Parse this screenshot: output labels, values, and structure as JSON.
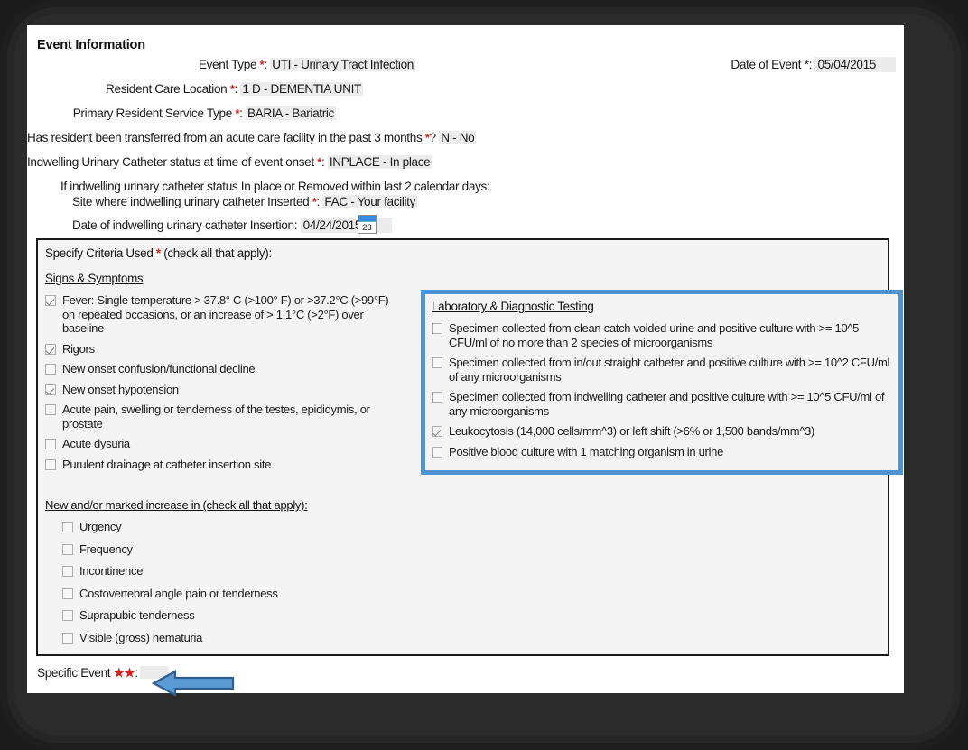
{
  "section": {
    "title": "Event Information"
  },
  "fields": [
    {
      "label": "Event Type",
      "required": true,
      "sep": ":",
      "value": "UTI - Urinary Tract Infection"
    },
    {
      "label": "Resident Care Location",
      "required": true,
      "sep": ":",
      "value": "1 D - DEMENTIA UNIT"
    },
    {
      "label": "Primary Resident Service Type",
      "required": true,
      "sep": ":",
      "value": "BARIA - Bariatric"
    },
    {
      "label": "Has resident been transferred from an acute care facility in the past 3 months",
      "required": true,
      "sep": "?",
      "value": "N - No"
    },
    {
      "label": "Indwelling Urinary Catheter status at time of event onset",
      "required": true,
      "sep": ":",
      "value": "INPLACE - In place"
    }
  ],
  "date_of_event": {
    "label": "Date of Event",
    "sep": ":",
    "value": "05/04/2015"
  },
  "conditional": {
    "note": "If indwelling urinary catheter status In place or Removed within last 2 calendar days:",
    "site_label": "Site where indwelling urinary catheter Inserted",
    "site_sep": ":",
    "site_value": "FAC - Your facility",
    "insertion_label": "Date of indwelling urinary catheter Insertion:",
    "insertion_value": "04/24/2015",
    "calendar_icon_day": "23"
  },
  "criteria": {
    "heading_pre": "Specify Criteria Used",
    "heading_post": "(check all that apply):",
    "signs_heading": "Signs & Symptoms",
    "signs": [
      {
        "label": "Fever: Single temperature > 37.8° C (>100° F) or >37.2°C (>99°F) on repeated occasions, or an increase of > 1.1°C (>2°F) over baseline",
        "checked": true
      },
      {
        "label": "Rigors",
        "checked": true
      },
      {
        "label": "New onset confusion/functional decline",
        "checked": false
      },
      {
        "label": "New onset hypotension",
        "checked": true
      },
      {
        "label": "Acute pain, swelling or tenderness of the testes, epididymis, or prostate",
        "checked": false
      },
      {
        "label": "Acute dysuria",
        "checked": false
      },
      {
        "label": "Purulent drainage at catheter insertion site",
        "checked": false
      }
    ],
    "increase_heading": "New and/or marked increase in (check all that apply):",
    "increase": [
      {
        "label": "Urgency",
        "checked": false
      },
      {
        "label": "Frequency",
        "checked": false
      },
      {
        "label": "Incontinence",
        "checked": false
      },
      {
        "label": "Costovertebral angle pain or tenderness",
        "checked": false
      },
      {
        "label": "Suprapubic tenderness",
        "checked": false
      },
      {
        "label": "Visible (gross) hematuria",
        "checked": false
      }
    ],
    "lab_heading": "Laboratory & Diagnostic Testing",
    "lab": [
      {
        "label": "Specimen collected from clean catch voided urine and positive culture with >= 10^5 CFU/ml of no more than 2 species of microorganisms",
        "checked": false
      },
      {
        "label": "Specimen collected from in/out straight catheter and positive culture with >= 10^2 CFU/ml of any microorganisms",
        "checked": false
      },
      {
        "label": "Specimen collected from indwelling catheter and positive culture with >= 10^5 CFU/ml of any microorganisms",
        "checked": false
      },
      {
        "label": "Leukocytosis (14,000 cells/mm^3) or left shift (>6% or 1,500 bands/mm^3)",
        "checked": true
      },
      {
        "label": "Positive blood culture with 1 matching organism in urine",
        "checked": false
      }
    ]
  },
  "specific_event": {
    "label": "Specific Event",
    "stars": "★★",
    "sep": ":",
    "value": ""
  },
  "colors": {
    "required_star": "#e01b1b",
    "highlight_box": "#4f93d3",
    "arrow_fill": "#5b9bd5",
    "arrow_stroke": "#2f5f90",
    "value_field_bg": "#ececec"
  }
}
